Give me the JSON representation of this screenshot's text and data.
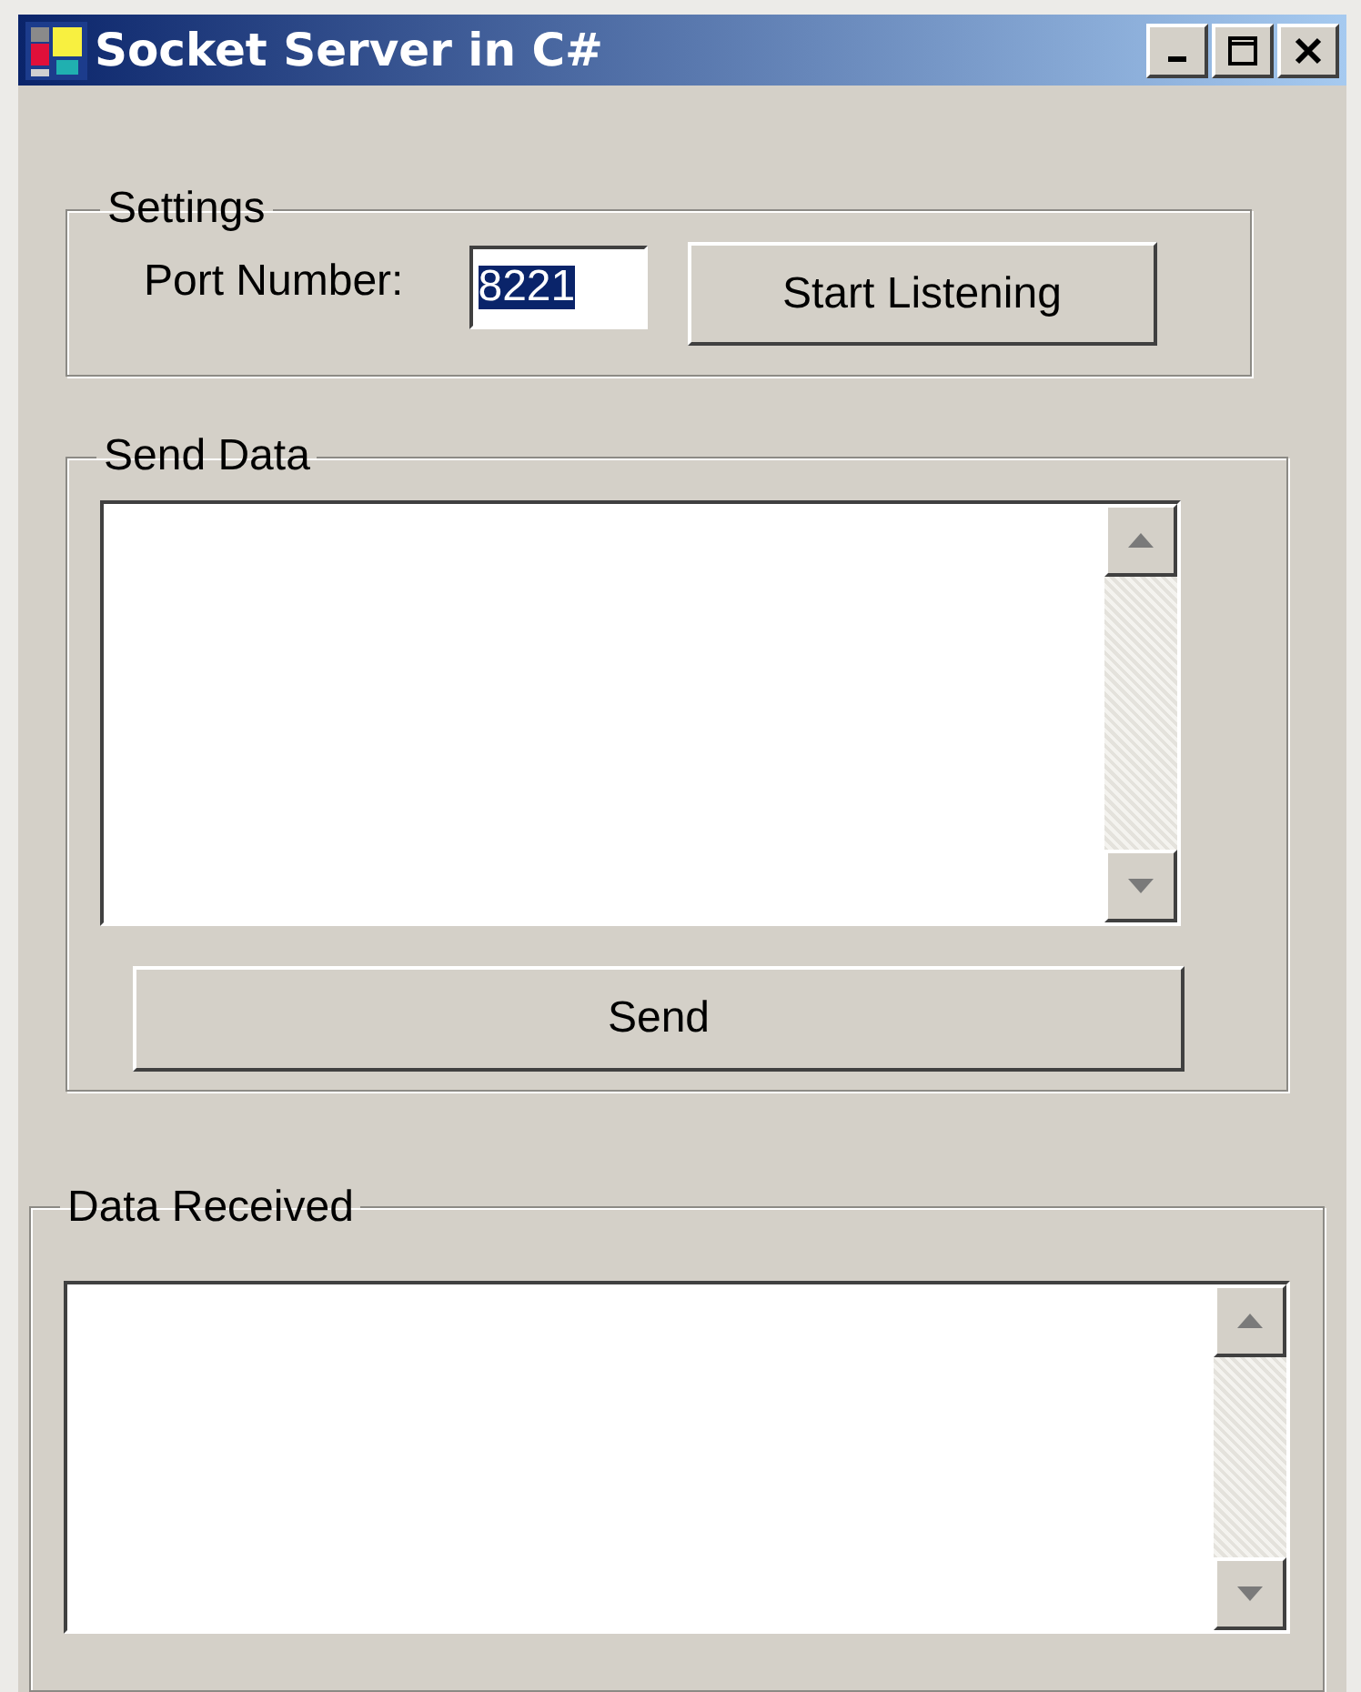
{
  "window": {
    "title": "Socket Server in C#"
  },
  "settings": {
    "title": "Settings",
    "port_label": "Port Number:",
    "port_field": {
      "value": "8221",
      "text_selected": true
    },
    "start_button": "Start Listening"
  },
  "send_data": {
    "title": "Send Data",
    "send_button": "Send"
  },
  "data_received": {
    "title": "Data Received"
  }
}
